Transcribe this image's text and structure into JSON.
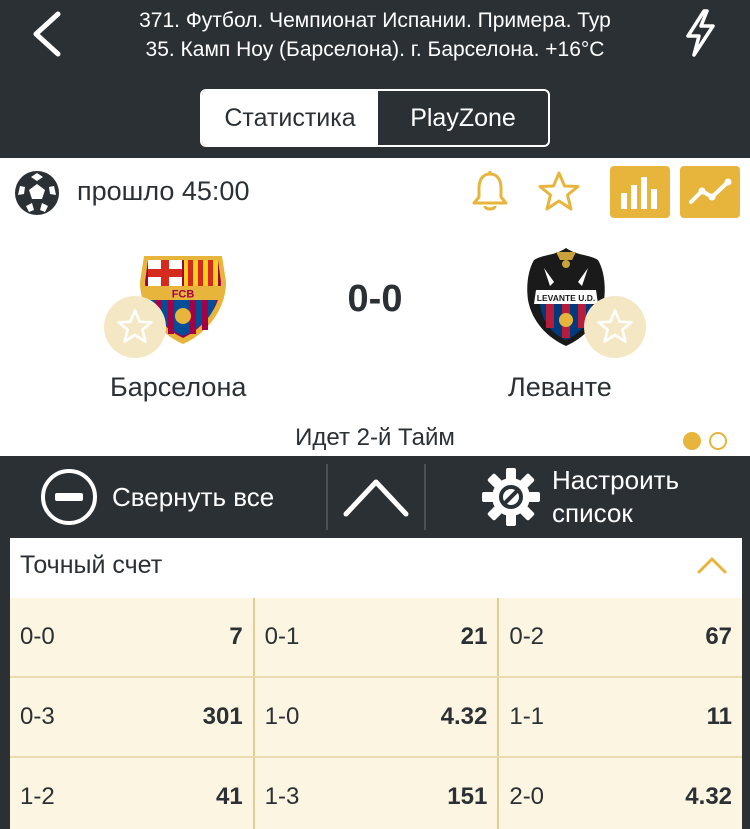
{
  "header": {
    "title_line1": "371. Футбол. Чемпионат Испании. Примера. Тур",
    "title_line2": "35. Камп Ноу (Барселона). г. Барселона. +16°C",
    "tabs": [
      {
        "label": "Статистика",
        "active": true
      },
      {
        "label": "PlayZone",
        "active": false
      }
    ]
  },
  "match": {
    "elapsed": "прошло 45:00",
    "score": "0-0",
    "home_team": "Барселона",
    "away_team": "Леванте",
    "period": "Идет 2-й  Тайм",
    "home_crest_text": "FCB",
    "away_crest_text": "LEVANTE U.D.",
    "pager": {
      "pages": 2,
      "current": 1
    }
  },
  "toolbar": {
    "collapse_label": "Свернуть все",
    "config_label_line1": "Настроить",
    "config_label_line2": "список"
  },
  "market": {
    "title": "Точный счет",
    "rows": [
      [
        {
          "score": "0-0",
          "odd": "7"
        },
        {
          "score": "0-1",
          "odd": "21"
        },
        {
          "score": "0-2",
          "odd": "67"
        }
      ],
      [
        {
          "score": "0-3",
          "odd": "301"
        },
        {
          "score": "1-0",
          "odd": "4.32"
        },
        {
          "score": "1-1",
          "odd": "11"
        }
      ],
      [
        {
          "score": "1-2",
          "odd": "41"
        },
        {
          "score": "1-3",
          "odd": "151"
        },
        {
          "score": "2-0",
          "odd": "4.32"
        }
      ]
    ]
  },
  "colors": {
    "dark": "#2b3034",
    "accent": "#e7b53b",
    "cell_bg": "#fbf5e2",
    "white": "#ffffff"
  },
  "icons": [
    "back-chevron-icon",
    "lightning-icon",
    "soccer-ball-icon",
    "bell-icon",
    "star-icon",
    "bar-chart-icon",
    "trend-line-icon",
    "minus-circle-icon",
    "chevron-up-icon",
    "gear-icon"
  ]
}
